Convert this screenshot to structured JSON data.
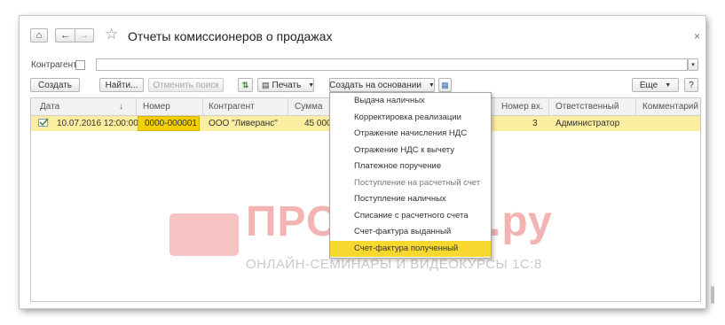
{
  "window": {
    "title": "Отчеты комиссионеров о продажах",
    "close_icon": "×"
  },
  "nav": {
    "home_icon": "⌂",
    "back_icon": "←",
    "forward_icon": "→",
    "star_icon": "☆"
  },
  "filter": {
    "label": "Контрагент:",
    "value": ""
  },
  "toolbar": {
    "create": "Создать",
    "find": "Найти...",
    "cancel_search": "Отменить поиск",
    "print": "Печать",
    "create_based_on": "Создать на основании",
    "more": "Еще",
    "help": "?"
  },
  "table": {
    "columns": [
      "Дата",
      "Номер",
      "Контрагент",
      "Сумма",
      "Номер вх.",
      "Ответственный",
      "Комментарий"
    ],
    "sort_icon": "↓",
    "rows": [
      {
        "date": "10.07.2016 12:00:00",
        "number": "0000-000001",
        "counterparty": "ООО \"Ливеранс\"",
        "sum": "45 000",
        "incoming_number": "3",
        "responsible": "Администратор",
        "comment": ""
      }
    ]
  },
  "menu": {
    "items": [
      "Выдача наличных",
      "Корректировка реализации",
      "Отражение начисления НДС",
      "Отражение НДС к вычету",
      "Платежное поручение",
      "Поступление на расчетный счет",
      "Поступление наличных",
      "Списание с расчетного счета",
      "Счет-фактура выданный",
      "Счет-фактура полученный"
    ],
    "highlighted_index": 9
  },
  "watermark": {
    "title": "ПРОФБУХ8.ру",
    "subtitle": "ОНЛАЙН-СЕМИНАРЫ И ВИДЕОКУРСЫ 1С:8"
  }
}
